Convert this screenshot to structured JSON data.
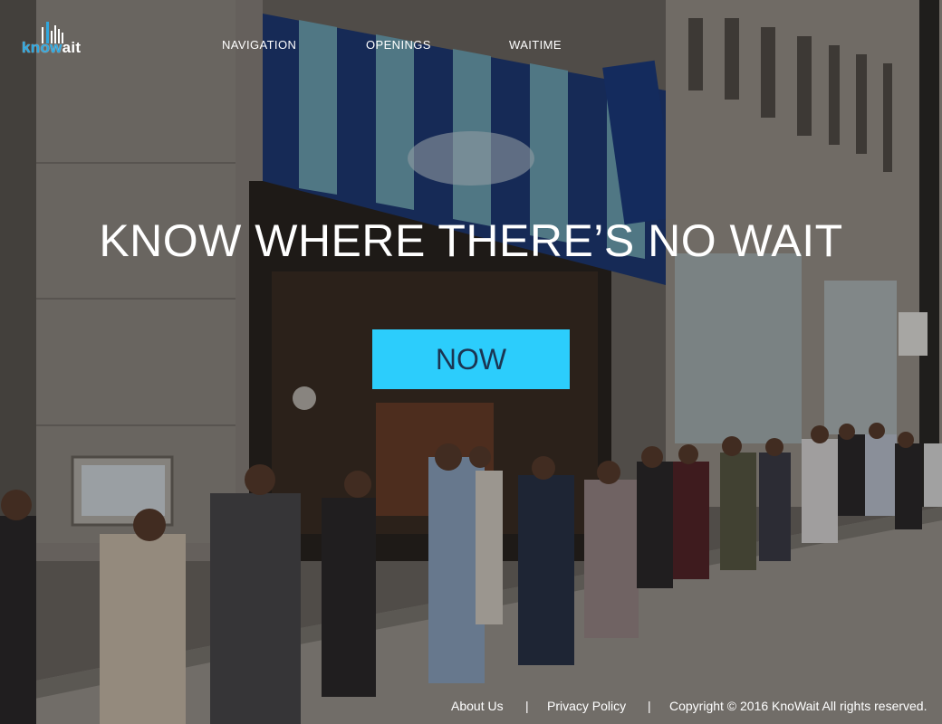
{
  "brand": {
    "logo_prefix": "know",
    "logo_suffix": "ait",
    "accent_color": "#2fa8e0"
  },
  "nav": {
    "items": [
      {
        "label": "NAVIGATION"
      },
      {
        "label": "OPENINGS"
      },
      {
        "label": "WAITIME"
      }
    ]
  },
  "hero": {
    "title": "KNOW WHERE THERE’S NO WAIT",
    "cta_label": "NOW",
    "cta_color": "#2ccdfc"
  },
  "footer": {
    "about": "About Us",
    "separator": "|",
    "privacy": "Privacy Policy",
    "copyright": "Copyright © 2016 KnoWait All rights reserved."
  }
}
